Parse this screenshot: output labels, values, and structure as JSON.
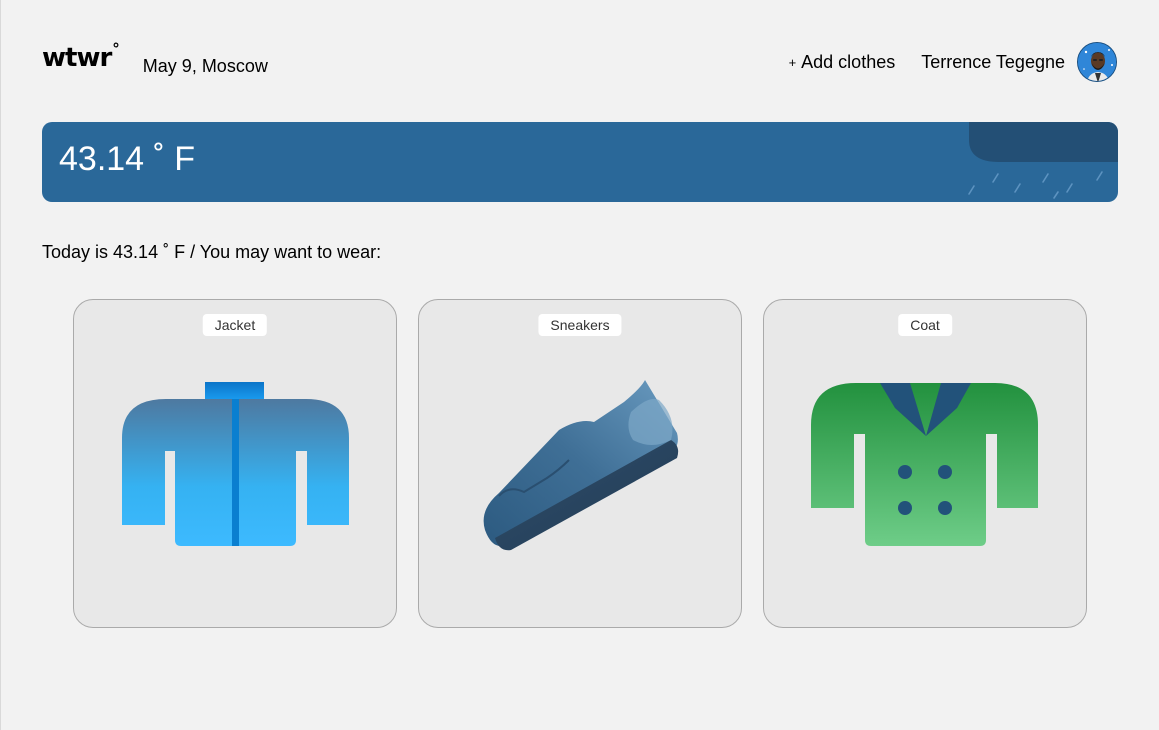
{
  "header": {
    "logo": "wtwr",
    "logo_degree": "°",
    "date_location": "May 9, Moscow",
    "add_clothes_plus": "+",
    "add_clothes_label": "Add clothes",
    "user_name": "Terrence Tegegne"
  },
  "weather": {
    "temperature": "43.14 ˚ F",
    "condition_icon": "rain-cloud-icon",
    "color": "#2a6899"
  },
  "recommendation": {
    "sentence": "Today is 43.14 ˚ F / You may want to wear:"
  },
  "items": [
    {
      "name": "Jacket",
      "icon": "jacket-icon"
    },
    {
      "name": "Sneakers",
      "icon": "sneakers-icon"
    },
    {
      "name": "Coat",
      "icon": "coat-icon"
    }
  ]
}
